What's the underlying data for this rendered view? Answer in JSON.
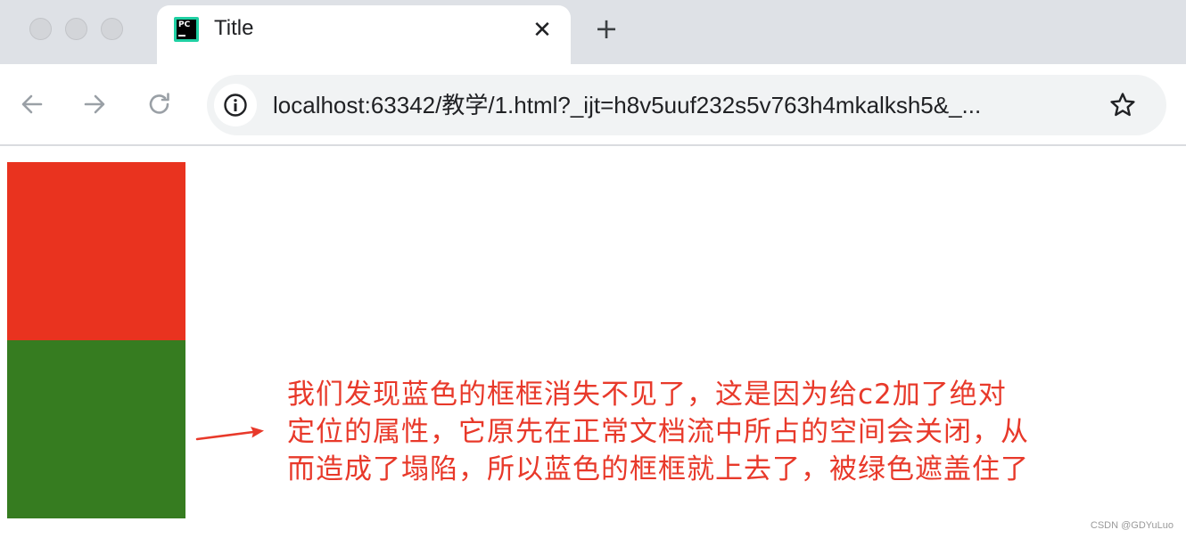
{
  "browser": {
    "tab": {
      "title": "Title",
      "favicon": "pycharm-icon",
      "favicon_text": "PC",
      "close_glyph": "✕"
    },
    "new_tab_glyph": "+",
    "address": {
      "url": "localhost:63342/教学/1.html?_ijt=h8v5uuf232s5v763h4mkalksh5&_..."
    },
    "icons": {
      "back": "arrow-left-icon",
      "forward": "arrow-right-icon",
      "reload": "reload-icon",
      "info": "info-icon",
      "bookmark": "star-icon"
    }
  },
  "page": {
    "boxes": [
      {
        "id": "c1",
        "color": "#e9331f"
      },
      {
        "id": "c3",
        "color": "#367c20"
      }
    ],
    "annotation": {
      "lines": [
        "我们发现蓝色的框框消失不见了，这是因为给c2加了绝对",
        "定位的属性，它原先在正常文档流中所占的空间会关闭，从",
        "而造成了塌陷，所以蓝色的框框就上去了，被绿色遮盖住了"
      ],
      "color": "#e8392a"
    },
    "watermark": "CSDN @GDYuLuo"
  },
  "colors": {
    "tabstrip": "#dee1e6",
    "omnibox": "#f1f3f4",
    "icon_gray": "#5f6368"
  }
}
